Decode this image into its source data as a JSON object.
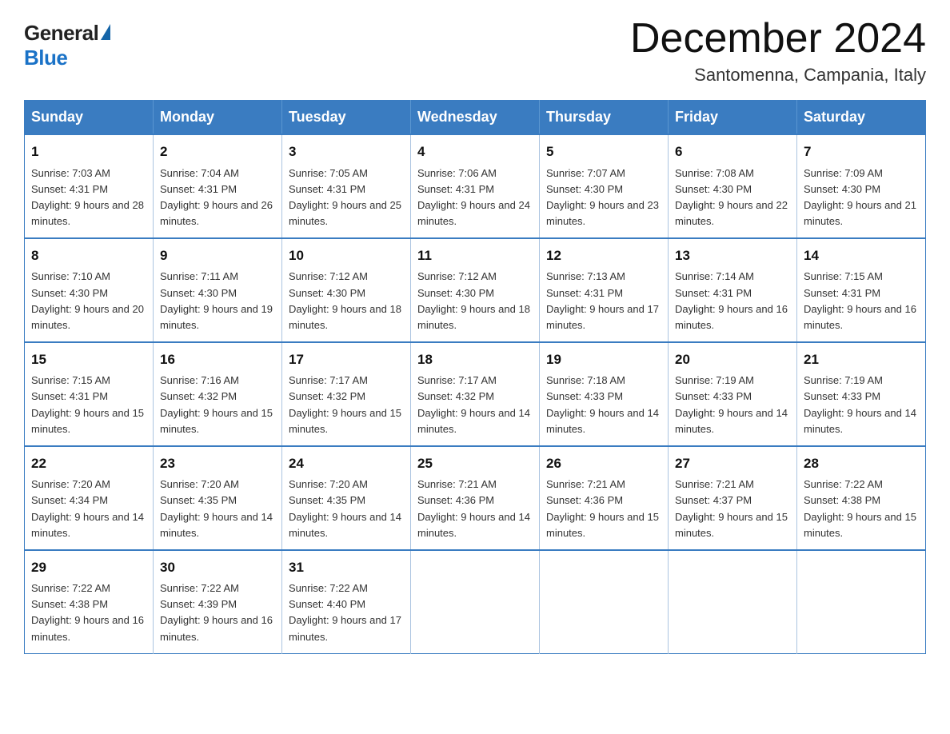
{
  "header": {
    "logo": {
      "general": "General",
      "blue": "Blue"
    },
    "title": "December 2024",
    "subtitle": "Santomenna, Campania, Italy"
  },
  "columns": [
    "Sunday",
    "Monday",
    "Tuesday",
    "Wednesday",
    "Thursday",
    "Friday",
    "Saturday"
  ],
  "weeks": [
    [
      {
        "day": "1",
        "sunrise": "7:03 AM",
        "sunset": "4:31 PM",
        "daylight": "9 hours and 28 minutes."
      },
      {
        "day": "2",
        "sunrise": "7:04 AM",
        "sunset": "4:31 PM",
        "daylight": "9 hours and 26 minutes."
      },
      {
        "day": "3",
        "sunrise": "7:05 AM",
        "sunset": "4:31 PM",
        "daylight": "9 hours and 25 minutes."
      },
      {
        "day": "4",
        "sunrise": "7:06 AM",
        "sunset": "4:31 PM",
        "daylight": "9 hours and 24 minutes."
      },
      {
        "day": "5",
        "sunrise": "7:07 AM",
        "sunset": "4:30 PM",
        "daylight": "9 hours and 23 minutes."
      },
      {
        "day": "6",
        "sunrise": "7:08 AM",
        "sunset": "4:30 PM",
        "daylight": "9 hours and 22 minutes."
      },
      {
        "day": "7",
        "sunrise": "7:09 AM",
        "sunset": "4:30 PM",
        "daylight": "9 hours and 21 minutes."
      }
    ],
    [
      {
        "day": "8",
        "sunrise": "7:10 AM",
        "sunset": "4:30 PM",
        "daylight": "9 hours and 20 minutes."
      },
      {
        "day": "9",
        "sunrise": "7:11 AM",
        "sunset": "4:30 PM",
        "daylight": "9 hours and 19 minutes."
      },
      {
        "day": "10",
        "sunrise": "7:12 AM",
        "sunset": "4:30 PM",
        "daylight": "9 hours and 18 minutes."
      },
      {
        "day": "11",
        "sunrise": "7:12 AM",
        "sunset": "4:30 PM",
        "daylight": "9 hours and 18 minutes."
      },
      {
        "day": "12",
        "sunrise": "7:13 AM",
        "sunset": "4:31 PM",
        "daylight": "9 hours and 17 minutes."
      },
      {
        "day": "13",
        "sunrise": "7:14 AM",
        "sunset": "4:31 PM",
        "daylight": "9 hours and 16 minutes."
      },
      {
        "day": "14",
        "sunrise": "7:15 AM",
        "sunset": "4:31 PM",
        "daylight": "9 hours and 16 minutes."
      }
    ],
    [
      {
        "day": "15",
        "sunrise": "7:15 AM",
        "sunset": "4:31 PM",
        "daylight": "9 hours and 15 minutes."
      },
      {
        "day": "16",
        "sunrise": "7:16 AM",
        "sunset": "4:32 PM",
        "daylight": "9 hours and 15 minutes."
      },
      {
        "day": "17",
        "sunrise": "7:17 AM",
        "sunset": "4:32 PM",
        "daylight": "9 hours and 15 minutes."
      },
      {
        "day": "18",
        "sunrise": "7:17 AM",
        "sunset": "4:32 PM",
        "daylight": "9 hours and 14 minutes."
      },
      {
        "day": "19",
        "sunrise": "7:18 AM",
        "sunset": "4:33 PM",
        "daylight": "9 hours and 14 minutes."
      },
      {
        "day": "20",
        "sunrise": "7:19 AM",
        "sunset": "4:33 PM",
        "daylight": "9 hours and 14 minutes."
      },
      {
        "day": "21",
        "sunrise": "7:19 AM",
        "sunset": "4:33 PM",
        "daylight": "9 hours and 14 minutes."
      }
    ],
    [
      {
        "day": "22",
        "sunrise": "7:20 AM",
        "sunset": "4:34 PM",
        "daylight": "9 hours and 14 minutes."
      },
      {
        "day": "23",
        "sunrise": "7:20 AM",
        "sunset": "4:35 PM",
        "daylight": "9 hours and 14 minutes."
      },
      {
        "day": "24",
        "sunrise": "7:20 AM",
        "sunset": "4:35 PM",
        "daylight": "9 hours and 14 minutes."
      },
      {
        "day": "25",
        "sunrise": "7:21 AM",
        "sunset": "4:36 PM",
        "daylight": "9 hours and 14 minutes."
      },
      {
        "day": "26",
        "sunrise": "7:21 AM",
        "sunset": "4:36 PM",
        "daylight": "9 hours and 15 minutes."
      },
      {
        "day": "27",
        "sunrise": "7:21 AM",
        "sunset": "4:37 PM",
        "daylight": "9 hours and 15 minutes."
      },
      {
        "day": "28",
        "sunrise": "7:22 AM",
        "sunset": "4:38 PM",
        "daylight": "9 hours and 15 minutes."
      }
    ],
    [
      {
        "day": "29",
        "sunrise": "7:22 AM",
        "sunset": "4:38 PM",
        "daylight": "9 hours and 16 minutes."
      },
      {
        "day": "30",
        "sunrise": "7:22 AM",
        "sunset": "4:39 PM",
        "daylight": "9 hours and 16 minutes."
      },
      {
        "day": "31",
        "sunrise": "7:22 AM",
        "sunset": "4:40 PM",
        "daylight": "9 hours and 17 minutes."
      },
      null,
      null,
      null,
      null
    ]
  ]
}
